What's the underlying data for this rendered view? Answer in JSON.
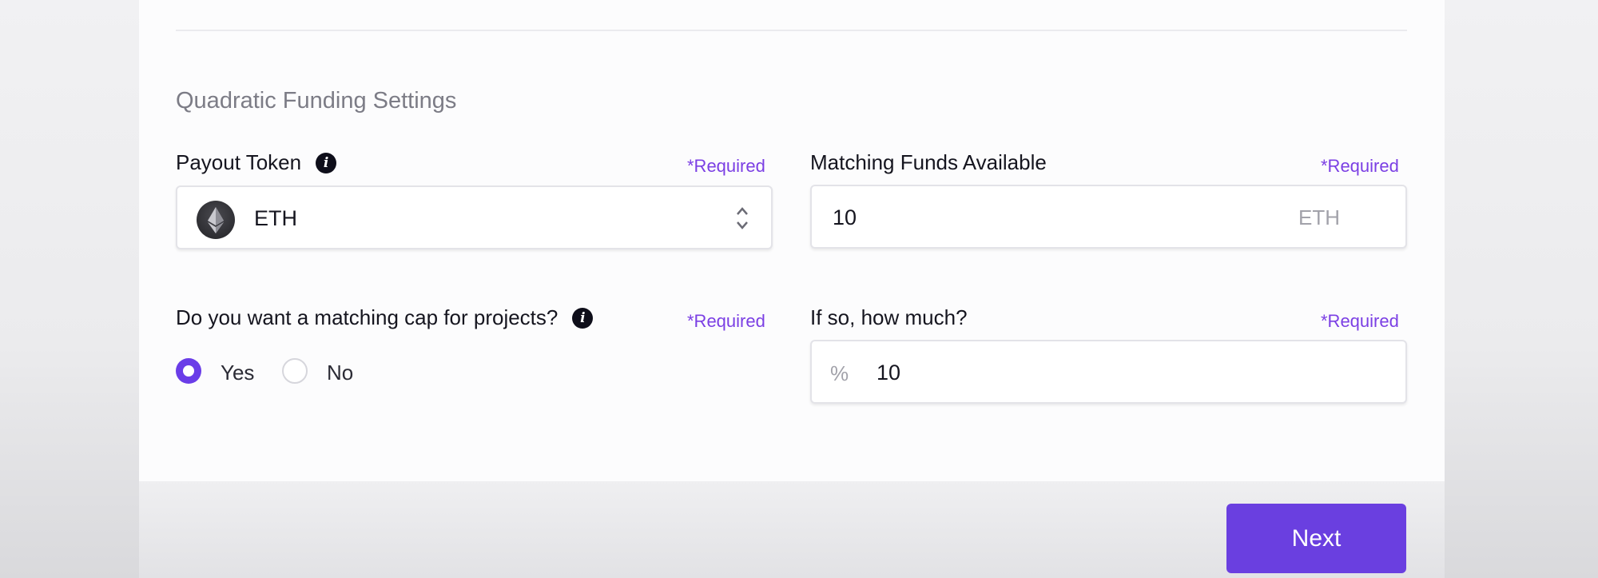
{
  "section_title": "Quadratic Funding Settings",
  "required_text": "*Required",
  "payout_token": {
    "label": "Payout Token",
    "value": "ETH",
    "icon": "ethereum-icon"
  },
  "matching_funds": {
    "label": "Matching Funds Available",
    "value": "10",
    "suffix": "ETH"
  },
  "matching_cap": {
    "label": "Do you want a matching cap for projects?",
    "options": [
      {
        "label": "Yes",
        "selected": true
      },
      {
        "label": "No",
        "selected": false
      }
    ]
  },
  "cap_amount": {
    "label": "If so, how much?",
    "prefix": "%",
    "value": "10"
  },
  "footer": {
    "next_label": "Next"
  },
  "colors": {
    "accent": "#6a3fe0",
    "required": "#7b3fe4"
  }
}
